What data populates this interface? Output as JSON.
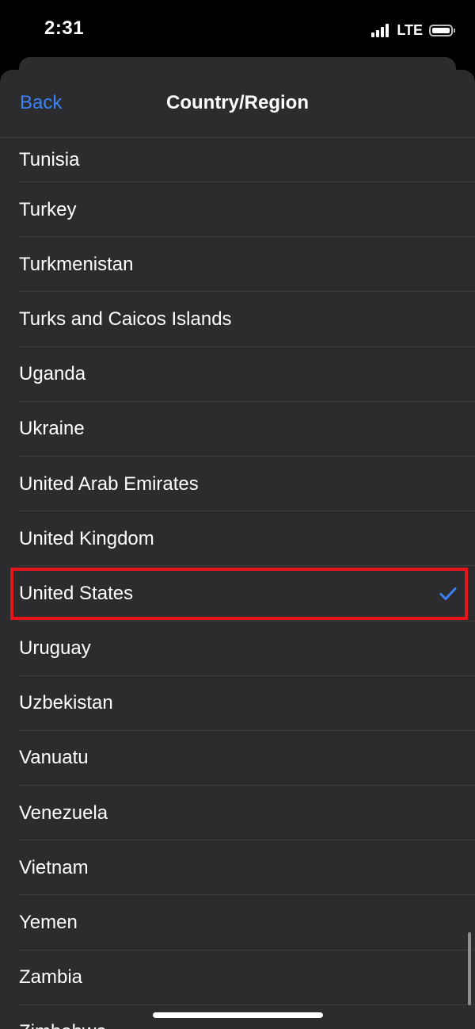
{
  "status_bar": {
    "time": "2:31",
    "network": "LTE",
    "icons": [
      "signal-icon",
      "battery-icon"
    ]
  },
  "nav": {
    "back_label": "Back",
    "title": "Country/Region"
  },
  "list": {
    "items": [
      {
        "label": "Tunisia",
        "selected": false
      },
      {
        "label": "Turkey",
        "selected": false
      },
      {
        "label": "Turkmenistan",
        "selected": false
      },
      {
        "label": "Turks and Caicos Islands",
        "selected": false
      },
      {
        "label": "Uganda",
        "selected": false
      },
      {
        "label": "Ukraine",
        "selected": false
      },
      {
        "label": "United Arab Emirates",
        "selected": false
      },
      {
        "label": "United Kingdom",
        "selected": false
      },
      {
        "label": "United States",
        "selected": true
      },
      {
        "label": "Uruguay",
        "selected": false
      },
      {
        "label": "Uzbekistan",
        "selected": false
      },
      {
        "label": "Vanuatu",
        "selected": false
      },
      {
        "label": "Venezuela",
        "selected": false
      },
      {
        "label": "Vietnam",
        "selected": false
      },
      {
        "label": "Yemen",
        "selected": false
      },
      {
        "label": "Zambia",
        "selected": false
      },
      {
        "label": "Zimbabwe",
        "selected": false
      }
    ]
  },
  "colors": {
    "accent": "#3b82f6",
    "sheet_background": "#2c2c2e",
    "highlight": "#e8141b",
    "separator": "#3d3d40"
  }
}
